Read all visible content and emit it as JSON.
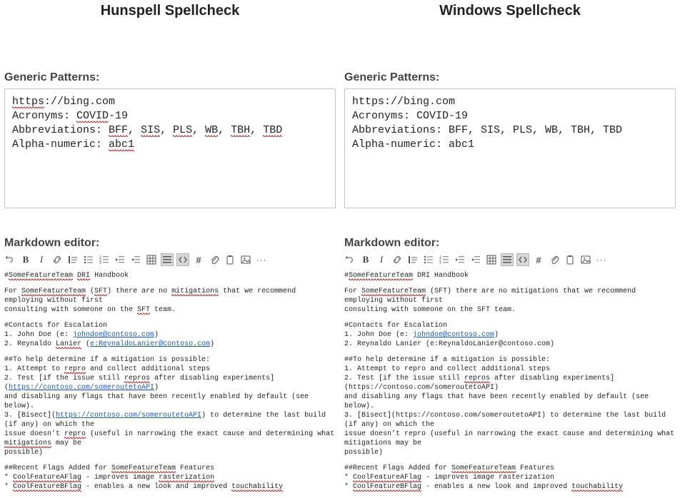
{
  "left": {
    "title": "Hunspell Spellcheck",
    "gp_label": "Generic Patterns:",
    "gp_lines": [
      {
        "segs": [
          {
            "t": "https",
            "e": true
          },
          {
            "t": "://bing.com"
          }
        ]
      },
      {
        "segs": [
          {
            "t": "Acronyms: "
          },
          {
            "t": "COVID",
            "e": true
          },
          {
            "t": "-19"
          }
        ]
      },
      {
        "segs": [
          {
            "t": "Abbreviations: "
          },
          {
            "t": "BFF",
            "e": true
          },
          {
            "t": ", "
          },
          {
            "t": "SIS",
            "e": true
          },
          {
            "t": ", "
          },
          {
            "t": "PLS",
            "e": true
          },
          {
            "t": ", "
          },
          {
            "t": "WB",
            "e": true
          },
          {
            "t": ", "
          },
          {
            "t": "TBH",
            "e": true
          },
          {
            "t": ", "
          },
          {
            "t": "TBD",
            "e": true
          }
        ]
      },
      {
        "segs": [
          {
            "t": "Alpha-numeric: "
          },
          {
            "t": "abc1",
            "e": true
          }
        ]
      }
    ],
    "md_label": "Markdown editor:",
    "toolbar_sel": [
      10,
      11
    ],
    "md": [
      [
        [
          {
            "t": "#"
          },
          {
            "t": "SomeFeatureTeam",
            "e": true
          },
          {
            "t": " "
          },
          {
            "t": "DRI",
            "e": true
          },
          {
            "t": " Handbook"
          }
        ]
      ],
      [
        [
          {
            "t": "For "
          },
          {
            "t": "SomeFeatureTeam",
            "e": true
          },
          {
            "t": " ("
          },
          {
            "t": "SFT",
            "e": true
          },
          {
            "t": ") there are no "
          },
          {
            "t": "mitigations",
            "e": true
          },
          {
            "t": " that we recommend employing without first"
          }
        ],
        [
          {
            "t": "consulting with someone on the "
          },
          {
            "t": "SFT",
            "e": true
          },
          {
            "t": " team."
          }
        ]
      ],
      [
        [
          {
            "t": "#Contacts for Escalation"
          }
        ],
        [
          {
            "t": "1. John Doe (e: "
          },
          {
            "t": "johndoe@contoso.com",
            "l": true
          },
          {
            "t": ")"
          }
        ],
        [
          {
            "t": "2. Reynaldo "
          },
          {
            "t": "Lanier",
            "e": true
          },
          {
            "t": " ("
          },
          {
            "t": "e:ReynaldoLanier@contoso.com",
            "l": true
          },
          {
            "t": ")"
          }
        ]
      ],
      [
        [
          {
            "t": "##To help determine if a mitigation is possible:"
          }
        ],
        [
          {
            "t": "1. Attempt to "
          },
          {
            "t": "repro",
            "e": true
          },
          {
            "t": " and collect additional steps"
          }
        ],
        [
          {
            "t": "2. Test [if the issue still "
          },
          {
            "t": "repros",
            "e": true
          },
          {
            "t": " after disabling experiments]("
          },
          {
            "t": "https://contoso.com/someroutetoAPI",
            "l": true
          },
          {
            "t": ")"
          }
        ],
        [
          {
            "t": "and disabling any flags that have been recently enabled by default (see below)."
          }
        ],
        [
          {
            "t": "3. [Bisect]("
          },
          {
            "t": "https://contoso.com/someroutetoAPI",
            "l": true
          },
          {
            "t": ") to determine the last build (if any) on which the"
          }
        ],
        [
          {
            "t": "issue doesn't "
          },
          {
            "t": "repro",
            "e": true
          },
          {
            "t": " (useful in narrowing the exact cause and determining what "
          },
          {
            "t": "mitigations",
            "e": true
          },
          {
            "t": " may be"
          }
        ],
        [
          {
            "t": "possible)"
          }
        ]
      ],
      [
        [
          {
            "t": "##Recent Flags Added for "
          },
          {
            "t": "SomeFeatureTeam",
            "e": true
          },
          {
            "t": " Features"
          }
        ],
        [
          {
            "t": "* "
          },
          {
            "t": "CoolFeatureAFlag",
            "e": true
          },
          {
            "t": " - improves image "
          },
          {
            "t": "rasterization",
            "e": true
          }
        ],
        [
          {
            "t": "* "
          },
          {
            "t": "CoolFeatureBFlag",
            "e": true
          },
          {
            "t": " - enables a new look and improved "
          },
          {
            "t": "touchability",
            "e": true
          }
        ]
      ]
    ]
  },
  "right": {
    "title": "Windows Spellcheck",
    "gp_label": "Generic Patterns:",
    "gp_lines": [
      {
        "segs": [
          {
            "t": "https://bing.com"
          }
        ]
      },
      {
        "segs": [
          {
            "t": "Acronyms: COVID-19"
          }
        ]
      },
      {
        "segs": [
          {
            "t": "Abbreviations: BFF, SIS, PLS, WB, TBH, TBD"
          }
        ]
      },
      {
        "segs": [
          {
            "t": "Alpha-numeric: abc1"
          }
        ]
      }
    ],
    "md_label": "Markdown editor:",
    "toolbar_sel": [
      10,
      11
    ],
    "md": [
      [
        [
          {
            "t": "#"
          },
          {
            "t": "SomeFeatureTeam",
            "e": true
          },
          {
            "t": " DRI Handbook"
          }
        ]
      ],
      [
        [
          {
            "t": "For "
          },
          {
            "t": "SomeFeatureTeam",
            "e": true
          },
          {
            "t": " (SFT) there are no mitigations that we recommend employing without first"
          }
        ],
        [
          {
            "t": "consulting with someone on the SFT team."
          }
        ]
      ],
      [
        [
          {
            "t": "#Contacts for Escalation"
          }
        ],
        [
          {
            "t": "1. John Doe (e: "
          },
          {
            "t": "johndoe@contoso.com",
            "l": true
          },
          {
            "t": ")"
          }
        ],
        [
          {
            "t": "2. Reynaldo Lanier (e:ReynaldoLanier@contoso.com)"
          }
        ]
      ],
      [
        [
          {
            "t": "##To help determine if a mitigation is possible:"
          }
        ],
        [
          {
            "t": "1. Attempt to repro and collect additional steps"
          }
        ],
        [
          {
            "t": "2. Test [if the issue still "
          },
          {
            "t": "repros",
            "e": true
          },
          {
            "t": " after disabling experiments](https://contoso.com/someroutetoAPI)"
          }
        ],
        [
          {
            "t": "and disabling any flags that have been recently enabled by default (see below)."
          }
        ],
        [
          {
            "t": "3. [Bisect](https://contoso.com/someroutetoAPI) to determine the last build (if any) on which the"
          }
        ],
        [
          {
            "t": "issue doesn't repro (useful in narrowing the exact cause and determining what mitigations may be"
          }
        ],
        [
          {
            "t": "possible)"
          }
        ]
      ],
      [
        [
          {
            "t": "##Recent Flags Added for "
          },
          {
            "t": "SomeFeatureTeam",
            "e": true
          },
          {
            "t": " Features"
          }
        ],
        [
          {
            "t": "* "
          },
          {
            "t": "CoolFeatureAFlag",
            "e": true
          },
          {
            "t": " - improves image rasterization"
          }
        ],
        [
          {
            "t": "* "
          },
          {
            "t": "CoolFeatureBFlag",
            "e": true
          },
          {
            "t": " - enables a new look and improved "
          },
          {
            "t": "touchability",
            "e": true
          }
        ]
      ]
    ]
  },
  "toolbar_items": [
    {
      "n": "undo-icon"
    },
    {
      "n": "bold-icon"
    },
    {
      "n": "italic-icon"
    },
    {
      "n": "link-icon"
    },
    {
      "n": "quote-icon"
    },
    {
      "n": "bullet-list-icon"
    },
    {
      "n": "numbered-list-icon"
    },
    {
      "n": "outdent-icon"
    },
    {
      "n": "indent-icon"
    },
    {
      "n": "table-icon"
    },
    {
      "n": "grid-icon"
    },
    {
      "n": "code-icon"
    },
    {
      "n": "hash-icon"
    },
    {
      "n": "attachment-icon"
    },
    {
      "n": "clipboard-icon"
    },
    {
      "n": "image-icon"
    },
    {
      "n": "more-icon"
    }
  ]
}
